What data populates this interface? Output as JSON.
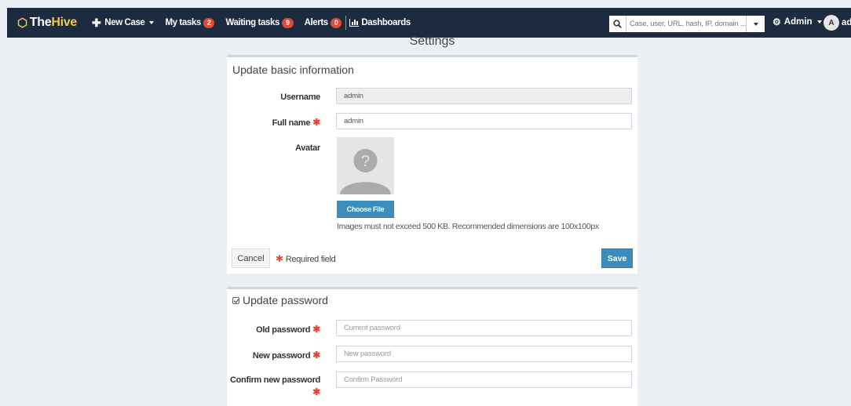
{
  "navbar": {
    "brand_prefix": "The",
    "brand_suffix": "Hive",
    "new_case": "New Case",
    "my_tasks": "My tasks",
    "my_tasks_count": "2",
    "waiting_tasks": "Waiting tasks",
    "waiting_tasks_count": "9",
    "alerts": "Alerts",
    "alerts_count": "0",
    "dashboards": "Dashboards",
    "search_placeholder": "Case, user, URL, hash, IP, domain ...",
    "admin_menu": "Admin",
    "avatar_letter": "A",
    "user_name": "admin"
  },
  "page": {
    "title": "Settings"
  },
  "basic_info": {
    "title": "Update basic information",
    "username_label": "Username",
    "username_value": "admin",
    "fullname_label": "Full name",
    "fullname_value": "admin",
    "avatar_label": "Avatar",
    "choose_file": "Choose File",
    "help_text": "Images must not exceed 500 KB. Recommended dimensions are 100x100px",
    "cancel": "Cancel",
    "required_note": "Required field",
    "save": "Save"
  },
  "password": {
    "title": "Update password",
    "checked": true,
    "old_label": "Old password",
    "old_placeholder": "Current password",
    "new_label": "New password",
    "new_placeholder": "New password",
    "confirm_label": "Confirm new password",
    "confirm_placeholder": "Confirm Password"
  },
  "required_marker": "✱",
  "colors": {
    "navbar_bg": "#1c2b40",
    "brand_accent": "#f2c94c",
    "badge": "#dd4b39",
    "primary": "#3c8dbc",
    "page_bg": "#ecf0f5"
  }
}
